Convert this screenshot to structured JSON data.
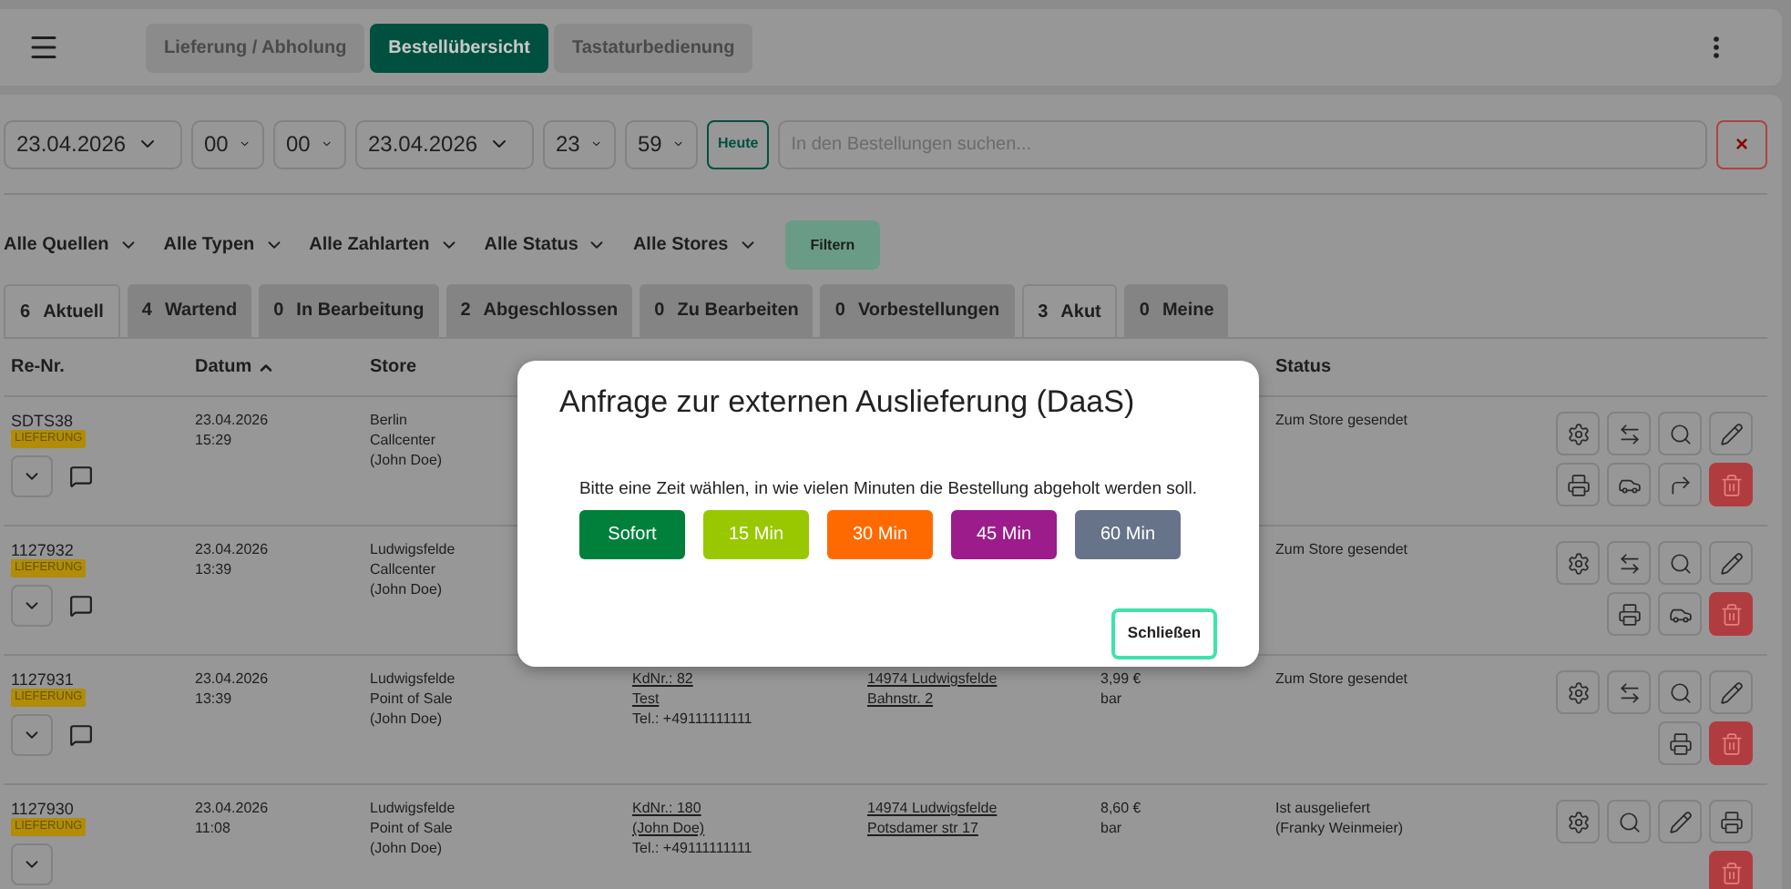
{
  "top_tabs": [
    {
      "label": "Lieferung / Abholung",
      "selected": false
    },
    {
      "label": "Bestellübersicht",
      "selected": true
    },
    {
      "label": "Tastaturbedienung",
      "selected": false
    }
  ],
  "date_filters": [
    {
      "kind": "date",
      "value": "23.04.2026"
    },
    {
      "kind": "time",
      "value": "00"
    },
    {
      "kind": "time",
      "value": "00"
    },
    {
      "kind": "date",
      "value": "23.04.2026"
    },
    {
      "kind": "time",
      "value": "23"
    },
    {
      "kind": "time",
      "value": "59"
    }
  ],
  "today_button": "Heute",
  "search": {
    "placeholder": "In den Bestellungen suchen..."
  },
  "clear_button": "×",
  "dropdowns": [
    "Alle Quellen",
    "Alle Typen",
    "Alle Zahlarten",
    "Alle Status",
    "Alle Stores"
  ],
  "filter_button": "Filtern",
  "status_tabs": [
    {
      "count": "6",
      "label": "Aktuell",
      "selected": true
    },
    {
      "count": "4",
      "label": "Wartend",
      "selected": false
    },
    {
      "count": "0",
      "label": "In Bearbeitung",
      "selected": false
    },
    {
      "count": "2",
      "label": "Abgeschlossen",
      "selected": false
    },
    {
      "count": "0",
      "label": "Zu Bearbeiten",
      "selected": false
    },
    {
      "count": "0",
      "label": "Vorbestellungen",
      "selected": false
    },
    {
      "count": "3",
      "label": "Akut",
      "selected": true
    },
    {
      "count": "0",
      "label": "Meine",
      "selected": false
    }
  ],
  "table": {
    "columns": [
      {
        "label": "Re-Nr.",
        "sorted": false
      },
      {
        "label": "Datum",
        "sorted": true
      },
      {
        "label": "Store",
        "sorted": false
      },
      {
        "label": "Status",
        "sorted": false
      }
    ],
    "rows": [
      {
        "number": "SDTS38",
        "badge": "LIEFERUNG",
        "has_note": true,
        "date": "23.04.2026",
        "time": "15:29",
        "store": [
          "Berlin",
          "Callcenter",
          "(John Doe)"
        ],
        "status": [
          "Zum Store gesendet"
        ],
        "actions": [
          {
            "kind": "settings"
          },
          {
            "kind": "swap"
          },
          {
            "kind": "search"
          },
          {
            "kind": "edit"
          },
          {
            "kind": "print"
          },
          {
            "kind": "car"
          },
          {
            "kind": "forward"
          },
          {
            "kind": "delete"
          }
        ]
      },
      {
        "number": "1127932",
        "badge": "LIEFERUNG",
        "has_note": true,
        "date": "23.04.2026",
        "time": "13:39",
        "store": [
          "Ludwigsfelde",
          "Callcenter",
          "(John Doe)"
        ],
        "status": [
          "Zum Store gesendet"
        ],
        "actions": [
          {
            "kind": "settings"
          },
          {
            "kind": "swap"
          },
          {
            "kind": "search"
          },
          {
            "kind": "edit"
          },
          {
            "kind": "print"
          },
          {
            "kind": "car"
          },
          {
            "kind": "delete"
          }
        ]
      },
      {
        "number": "1127931",
        "badge": "LIEFERUNG",
        "has_note": true,
        "date": "23.04.2026",
        "time": "13:39",
        "store": [
          "Ludwigsfelde",
          "Point of Sale",
          "(John Doe)"
        ],
        "customer_id": "KdNr.: 82",
        "customer_name": "Test",
        "phone": "Tel.: +49111111111",
        "address": [
          "14974 Ludwigsfelde",
          "Bahnstr. 2"
        ],
        "amount": "3,99 €",
        "payment": "bar",
        "status": [
          "Zum Store gesendet"
        ],
        "actions": [
          {
            "kind": "settings"
          },
          {
            "kind": "swap"
          },
          {
            "kind": "search"
          },
          {
            "kind": "edit"
          },
          {
            "kind": "print"
          },
          {
            "kind": "delete"
          }
        ]
      },
      {
        "number": "1127930",
        "badge": "LIEFERUNG",
        "has_note": false,
        "date": "23.04.2026",
        "time": "11:08",
        "store": [
          "Ludwigsfelde",
          "Point of Sale",
          "(John Doe)"
        ],
        "customer_id": "KdNr.: 180",
        "customer_name": "(John Doe)",
        "phone": "Tel.: +49111111111",
        "address": [
          "14974 Ludwigsfelde",
          "Potsdamer str 17"
        ],
        "amount": "8,60 €",
        "payment": "bar",
        "status": [
          "Ist ausgeliefert",
          "(Franky Weinmeier)"
        ],
        "actions": [
          {
            "kind": "settings"
          },
          {
            "kind": "search"
          },
          {
            "kind": "edit"
          },
          {
            "kind": "print"
          },
          {
            "kind": "delete"
          }
        ]
      }
    ]
  },
  "dialog": {
    "title": "Anfrage zur externen Auslieferung (DaaS)",
    "message": "Bitte eine Zeit wählen, in wie vielen Minuten die Bestellung abgeholt werden soll.",
    "options": [
      {
        "label": "Sofort",
        "color": "#00803a"
      },
      {
        "label": "15 Min",
        "color": "#99c800"
      },
      {
        "label": "30 Min",
        "color": "#ff6a00"
      },
      {
        "label": "45 Min",
        "color": "#9b1c8a"
      },
      {
        "label": "60 Min",
        "color": "#667389"
      }
    ],
    "close_button": "Schließen"
  }
}
